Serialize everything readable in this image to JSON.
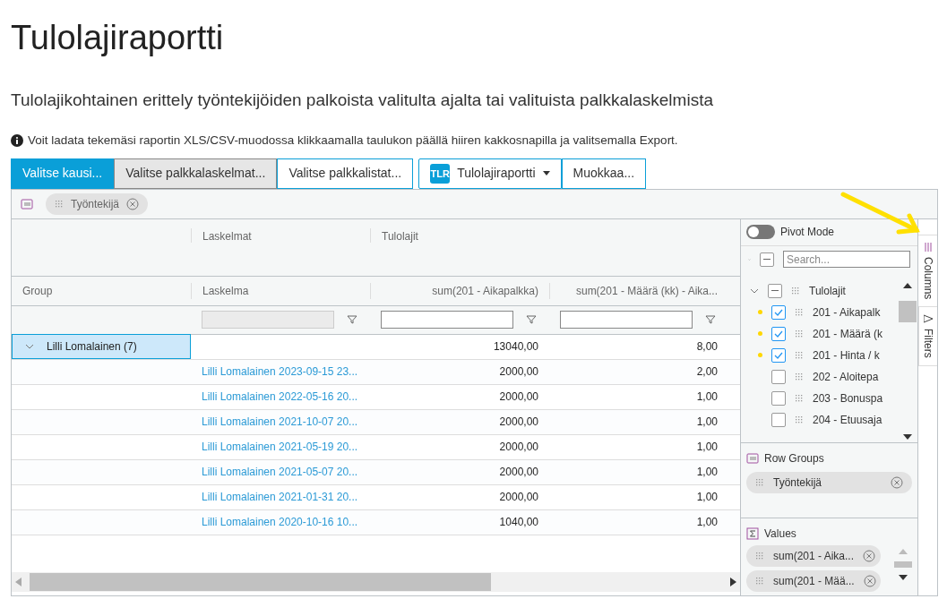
{
  "title": "Tulolajiraportti",
  "subtitle": "Tulolajikohtainen erittely työntekijöiden palkoista valitulta ajalta tai valituista palkkalaskelmista",
  "info": "Voit ladata tekemäsi raportin XLS/CSV-muodossa klikkaamalla taulukon päällä hiiren kakkosnapilla ja valitsemalla Export.",
  "toolbar": [
    {
      "kind": "primary",
      "label": "Valitse kausi..."
    },
    {
      "kind": "pressed",
      "label": "Valitse palkkalaskelmat..."
    },
    {
      "kind": "plain",
      "label": "Valitse palkkalistat..."
    },
    {
      "kind": "report",
      "logo": "TLR",
      "label": "Tulolajiraportti"
    },
    {
      "kind": "plain",
      "label": "Muokkaa..."
    }
  ],
  "grid": {
    "drop_zone": [
      {
        "label": "Työntekijä"
      }
    ],
    "group_headers": [
      "Laskelmat",
      "Tulolajit"
    ],
    "columns": [
      {
        "label": "Group",
        "kind": "group"
      },
      {
        "label": "Laskelma",
        "kind": "link"
      },
      {
        "label": "sum(201 - Aikapalkka)",
        "kind": "amount"
      },
      {
        "label": "sum(201 - Määrä (kk) - Aika...",
        "kind": "amount"
      }
    ],
    "group_row": {
      "label": "Lilli Lomalainen (7)",
      "expanded": true,
      "selected": true,
      "values": [
        "13040,00",
        "8,00"
      ]
    },
    "rows": [
      {
        "laskelma": "Lilli Lomalainen 2023-09-15 23...",
        "values": [
          "2000,00",
          "2,00"
        ]
      },
      {
        "laskelma": "Lilli Lomalainen 2022-05-16 20...",
        "values": [
          "2000,00",
          "1,00"
        ]
      },
      {
        "laskelma": "Lilli Lomalainen 2021-10-07 20...",
        "values": [
          "2000,00",
          "1,00"
        ]
      },
      {
        "laskelma": "Lilli Lomalainen 2021-05-19 20...",
        "values": [
          "2000,00",
          "1,00"
        ]
      },
      {
        "laskelma": "Lilli Lomalainen 2021-05-07 20...",
        "values": [
          "2000,00",
          "1,00"
        ]
      },
      {
        "laskelma": "Lilli Lomalainen 2021-01-31 20...",
        "values": [
          "2000,00",
          "1,00"
        ]
      },
      {
        "laskelma": "Lilli Lomalainen 2020-10-16 10...",
        "values": [
          "1040,00",
          "1,00"
        ]
      }
    ]
  },
  "side_panel": {
    "pivot_mode": {
      "label": "Pivot Mode",
      "on": false
    },
    "search": {
      "placeholder": "Search...",
      "select_all_indeterminate": true
    },
    "column_group": {
      "label": "Tulolajit",
      "expanded": true,
      "indeterminate": true,
      "children": [
        {
          "label": "201 - Aikapalk",
          "checked": true,
          "in_values": true
        },
        {
          "label": "201 - Määrä (k",
          "checked": true,
          "in_values": true
        },
        {
          "label": "201 - Hinta / k",
          "checked": true,
          "in_values": true
        },
        {
          "label": "202 - Aloitepa",
          "checked": false,
          "in_values": false
        },
        {
          "label": "203 - Bonuspa",
          "checked": false,
          "in_values": false
        },
        {
          "label": "204 - Etuusaja",
          "checked": false,
          "in_values": false
        }
      ]
    },
    "row_groups": {
      "title": "Row Groups",
      "chips": [
        {
          "label": "Työntekijä"
        }
      ]
    },
    "values": {
      "title": "Values",
      "chips": [
        {
          "label": "sum(201 - Aika..."
        },
        {
          "label": "sum(201 - Mää..."
        }
      ]
    },
    "tabs": [
      {
        "label": "Columns",
        "selected": true
      },
      {
        "label": "Filters",
        "selected": false
      }
    ]
  }
}
